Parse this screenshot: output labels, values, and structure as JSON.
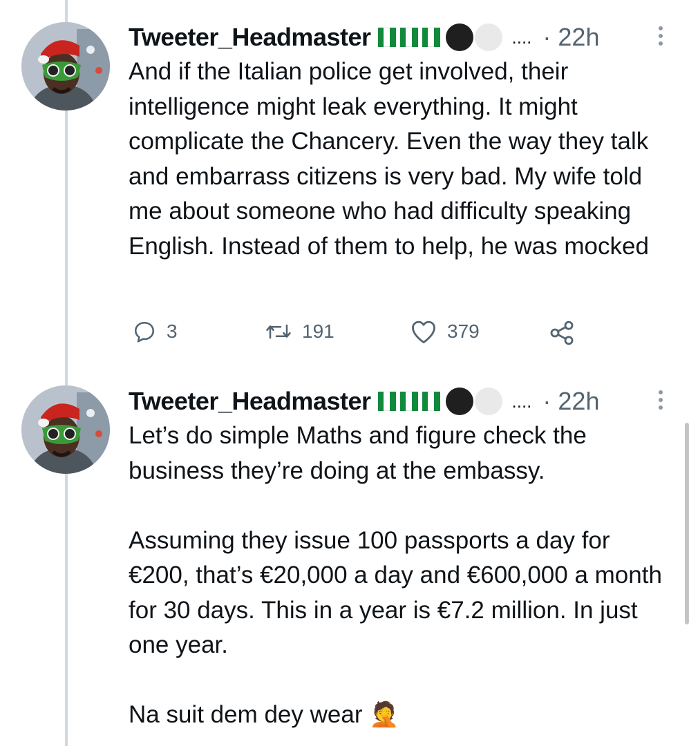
{
  "tweets": [
    {
      "username": "Tweeter_Headmaster",
      "ellipsis": "....",
      "time": "· 22h",
      "text": "And if the Italian police get involved, their intelligence might leak everything. It might complicate the Chancery. Even the way they talk and embarrass citizens is very bad. My wife told me about someone who had difficulty speaking English. Instead of them to help, he was mocked",
      "actions": {
        "replies": "3",
        "retweets": "191",
        "likes": "379"
      }
    },
    {
      "username": "Tweeter_Headmaster",
      "ellipsis": "....",
      "time": "· 22h",
      "text": "Let’s do simple Maths and figure check the business they’re doing at the embassy.\n\nAssuming they issue 100 passports a day for €200, that’s €20,000 a day and €600,000 a month for 30 days. This in a year is €7.2 million. In just one year.\n\nNa suit dem dey wear 🤦"
    }
  ],
  "icons": {
    "reply": "reply-icon",
    "retweet": "retweet-icon",
    "like": "heart-icon",
    "share": "share-icon",
    "more": "more-options-icon"
  },
  "colors": {
    "text": "#0f1419",
    "secondary": "#536471",
    "thread_line": "#cfd9de",
    "flag_green": "#128a3c"
  }
}
